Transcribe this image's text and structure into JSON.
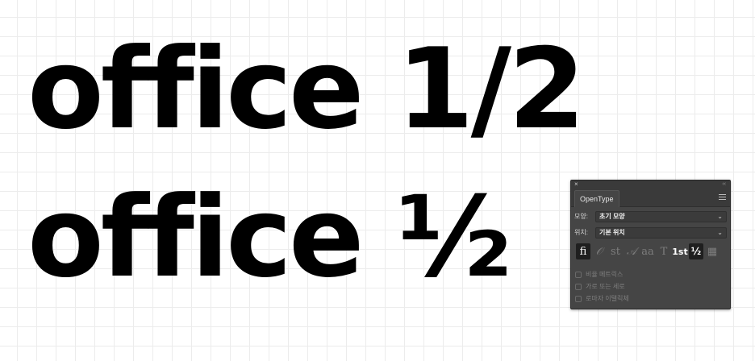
{
  "canvas": {
    "line1": "office 1/2",
    "line2": "office ½"
  },
  "panel": {
    "title": "OpenType",
    "close_glyph": "×",
    "collapse_glyph": "‹‹",
    "shape": {
      "label": "모양:",
      "value": "초기 모양"
    },
    "position": {
      "label": "위치:",
      "value": "기본 위치"
    },
    "feature_icons": [
      {
        "glyph": "fi",
        "name": "standard-ligatures-icon",
        "state": "selected"
      },
      {
        "glyph": "𝒪",
        "name": "contextual-alternates-icon",
        "state": "disabled"
      },
      {
        "glyph": "st",
        "name": "discretionary-ligatures-icon",
        "state": "disabled"
      },
      {
        "glyph": "𝒜",
        "name": "swash-icon",
        "state": "disabled"
      },
      {
        "glyph": "aa",
        "name": "stylistic-alternates-icon",
        "state": "disabled"
      },
      {
        "glyph": "T",
        "name": "titling-alternates-icon",
        "state": "disabled"
      },
      {
        "glyph": "1st",
        "name": "ordinals-icon",
        "state": "active"
      },
      {
        "glyph": "½",
        "name": "fractions-icon",
        "state": "selected"
      },
      {
        "glyph": "▦",
        "name": "stylistic-sets-icon",
        "state": "disabled"
      }
    ],
    "checkboxes": [
      {
        "label": "비율 메트릭스",
        "checked": false
      },
      {
        "label": "가로 또는 세로",
        "checked": false
      },
      {
        "label": "로마자 이탤릭체",
        "checked": false
      }
    ]
  },
  "colors": {
    "panel_bg": "#454545",
    "panel_header": "#3a3a3a",
    "selected_icon_bg": "#1f1f1f",
    "text_main": "#000000"
  }
}
